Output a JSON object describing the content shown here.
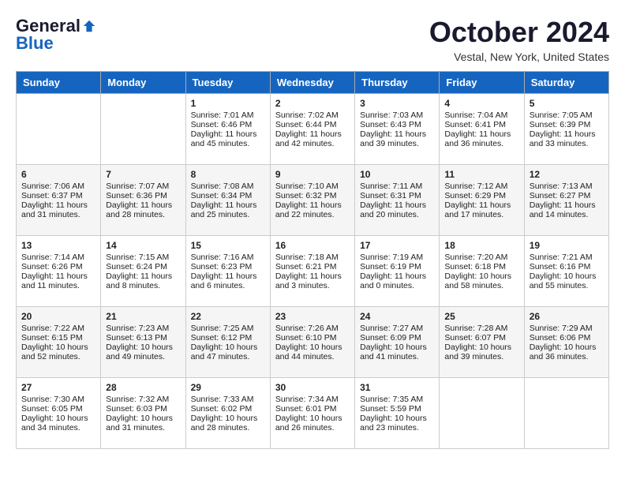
{
  "header": {
    "logo_general": "General",
    "logo_blue": "Blue",
    "month_title": "October 2024",
    "location": "Vestal, New York, United States"
  },
  "weekdays": [
    "Sunday",
    "Monday",
    "Tuesday",
    "Wednesday",
    "Thursday",
    "Friday",
    "Saturday"
  ],
  "weeks": [
    [
      {
        "day": "",
        "content": ""
      },
      {
        "day": "",
        "content": ""
      },
      {
        "day": "1",
        "line1": "Sunrise: 7:01 AM",
        "line2": "Sunset: 6:46 PM",
        "line3": "Daylight: 11 hours",
        "line4": "and 45 minutes."
      },
      {
        "day": "2",
        "line1": "Sunrise: 7:02 AM",
        "line2": "Sunset: 6:44 PM",
        "line3": "Daylight: 11 hours",
        "line4": "and 42 minutes."
      },
      {
        "day": "3",
        "line1": "Sunrise: 7:03 AM",
        "line2": "Sunset: 6:43 PM",
        "line3": "Daylight: 11 hours",
        "line4": "and 39 minutes."
      },
      {
        "day": "4",
        "line1": "Sunrise: 7:04 AM",
        "line2": "Sunset: 6:41 PM",
        "line3": "Daylight: 11 hours",
        "line4": "and 36 minutes."
      },
      {
        "day": "5",
        "line1": "Sunrise: 7:05 AM",
        "line2": "Sunset: 6:39 PM",
        "line3": "Daylight: 11 hours",
        "line4": "and 33 minutes."
      }
    ],
    [
      {
        "day": "6",
        "line1": "Sunrise: 7:06 AM",
        "line2": "Sunset: 6:37 PM",
        "line3": "Daylight: 11 hours",
        "line4": "and 31 minutes."
      },
      {
        "day": "7",
        "line1": "Sunrise: 7:07 AM",
        "line2": "Sunset: 6:36 PM",
        "line3": "Daylight: 11 hours",
        "line4": "and 28 minutes."
      },
      {
        "day": "8",
        "line1": "Sunrise: 7:08 AM",
        "line2": "Sunset: 6:34 PM",
        "line3": "Daylight: 11 hours",
        "line4": "and 25 minutes."
      },
      {
        "day": "9",
        "line1": "Sunrise: 7:10 AM",
        "line2": "Sunset: 6:32 PM",
        "line3": "Daylight: 11 hours",
        "line4": "and 22 minutes."
      },
      {
        "day": "10",
        "line1": "Sunrise: 7:11 AM",
        "line2": "Sunset: 6:31 PM",
        "line3": "Daylight: 11 hours",
        "line4": "and 20 minutes."
      },
      {
        "day": "11",
        "line1": "Sunrise: 7:12 AM",
        "line2": "Sunset: 6:29 PM",
        "line3": "Daylight: 11 hours",
        "line4": "and 17 minutes."
      },
      {
        "day": "12",
        "line1": "Sunrise: 7:13 AM",
        "line2": "Sunset: 6:27 PM",
        "line3": "Daylight: 11 hours",
        "line4": "and 14 minutes."
      }
    ],
    [
      {
        "day": "13",
        "line1": "Sunrise: 7:14 AM",
        "line2": "Sunset: 6:26 PM",
        "line3": "Daylight: 11 hours",
        "line4": "and 11 minutes."
      },
      {
        "day": "14",
        "line1": "Sunrise: 7:15 AM",
        "line2": "Sunset: 6:24 PM",
        "line3": "Daylight: 11 hours",
        "line4": "and 8 minutes."
      },
      {
        "day": "15",
        "line1": "Sunrise: 7:16 AM",
        "line2": "Sunset: 6:23 PM",
        "line3": "Daylight: 11 hours",
        "line4": "and 6 minutes."
      },
      {
        "day": "16",
        "line1": "Sunrise: 7:18 AM",
        "line2": "Sunset: 6:21 PM",
        "line3": "Daylight: 11 hours",
        "line4": "and 3 minutes."
      },
      {
        "day": "17",
        "line1": "Sunrise: 7:19 AM",
        "line2": "Sunset: 6:19 PM",
        "line3": "Daylight: 11 hours",
        "line4": "and 0 minutes."
      },
      {
        "day": "18",
        "line1": "Sunrise: 7:20 AM",
        "line2": "Sunset: 6:18 PM",
        "line3": "Daylight: 10 hours",
        "line4": "and 58 minutes."
      },
      {
        "day": "19",
        "line1": "Sunrise: 7:21 AM",
        "line2": "Sunset: 6:16 PM",
        "line3": "Daylight: 10 hours",
        "line4": "and 55 minutes."
      }
    ],
    [
      {
        "day": "20",
        "line1": "Sunrise: 7:22 AM",
        "line2": "Sunset: 6:15 PM",
        "line3": "Daylight: 10 hours",
        "line4": "and 52 minutes."
      },
      {
        "day": "21",
        "line1": "Sunrise: 7:23 AM",
        "line2": "Sunset: 6:13 PM",
        "line3": "Daylight: 10 hours",
        "line4": "and 49 minutes."
      },
      {
        "day": "22",
        "line1": "Sunrise: 7:25 AM",
        "line2": "Sunset: 6:12 PM",
        "line3": "Daylight: 10 hours",
        "line4": "and 47 minutes."
      },
      {
        "day": "23",
        "line1": "Sunrise: 7:26 AM",
        "line2": "Sunset: 6:10 PM",
        "line3": "Daylight: 10 hours",
        "line4": "and 44 minutes."
      },
      {
        "day": "24",
        "line1": "Sunrise: 7:27 AM",
        "line2": "Sunset: 6:09 PM",
        "line3": "Daylight: 10 hours",
        "line4": "and 41 minutes."
      },
      {
        "day": "25",
        "line1": "Sunrise: 7:28 AM",
        "line2": "Sunset: 6:07 PM",
        "line3": "Daylight: 10 hours",
        "line4": "and 39 minutes."
      },
      {
        "day": "26",
        "line1": "Sunrise: 7:29 AM",
        "line2": "Sunset: 6:06 PM",
        "line3": "Daylight: 10 hours",
        "line4": "and 36 minutes."
      }
    ],
    [
      {
        "day": "27",
        "line1": "Sunrise: 7:30 AM",
        "line2": "Sunset: 6:05 PM",
        "line3": "Daylight: 10 hours",
        "line4": "and 34 minutes."
      },
      {
        "day": "28",
        "line1": "Sunrise: 7:32 AM",
        "line2": "Sunset: 6:03 PM",
        "line3": "Daylight: 10 hours",
        "line4": "and 31 minutes."
      },
      {
        "day": "29",
        "line1": "Sunrise: 7:33 AM",
        "line2": "Sunset: 6:02 PM",
        "line3": "Daylight: 10 hours",
        "line4": "and 28 minutes."
      },
      {
        "day": "30",
        "line1": "Sunrise: 7:34 AM",
        "line2": "Sunset: 6:01 PM",
        "line3": "Daylight: 10 hours",
        "line4": "and 26 minutes."
      },
      {
        "day": "31",
        "line1": "Sunrise: 7:35 AM",
        "line2": "Sunset: 5:59 PM",
        "line3": "Daylight: 10 hours",
        "line4": "and 23 minutes."
      },
      {
        "day": "",
        "content": ""
      },
      {
        "day": "",
        "content": ""
      }
    ]
  ]
}
